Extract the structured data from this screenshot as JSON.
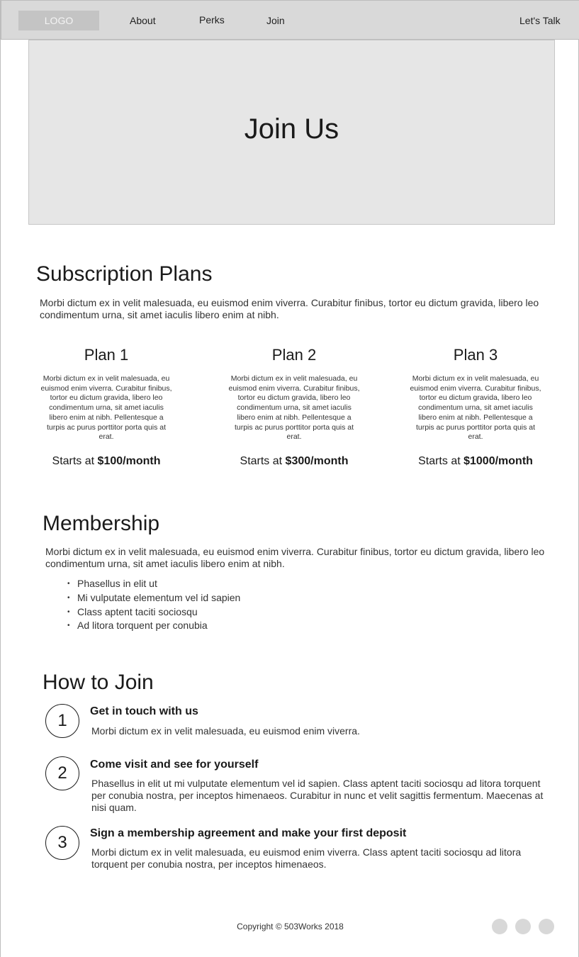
{
  "nav": {
    "logo": "LOGO",
    "links": [
      "About",
      "Perks",
      "Join"
    ],
    "cta": "Let's Talk"
  },
  "hero": {
    "title": "Join Us"
  },
  "subscription": {
    "title": "Subscription Plans",
    "intro": "Morbi dictum ex in velit malesuada, eu euismod enim viverra. Curabitur finibus, tortor eu dictum gravida, libero leo condimentum urna, sit amet iaculis libero enim at nibh.",
    "plans": [
      {
        "name": "Plan 1",
        "description": "Morbi dictum ex in velit malesuada, eu euismod enim viverra. Curabitur finibus, tortor eu dictum gravida, libero leo condimentum urna, sit amet iaculis libero enim at nibh. Pellentesque a turpis ac purus porttitor porta quis at erat.",
        "price_prefix": "Starts at",
        "price": "$100/month"
      },
      {
        "name": "Plan 2",
        "description": "Morbi dictum ex in velit malesuada, eu euismod enim viverra. Curabitur finibus, tortor eu dictum gravida, libero leo condimentum urna, sit amet iaculis libero enim at nibh. Pellentesque a turpis ac purus porttitor porta quis at erat.",
        "price_prefix": "Starts at",
        "price": "$300/month"
      },
      {
        "name": "Plan 3",
        "description": "Morbi dictum ex in velit malesuada, eu euismod enim viverra. Curabitur finibus, tortor eu dictum gravida, libero leo condimentum urna, sit amet iaculis libero enim at nibh. Pellentesque a turpis ac purus porttitor porta quis at erat.",
        "price_prefix": "Starts at",
        "price": "$1000/month"
      }
    ]
  },
  "membership": {
    "title": "Membership",
    "intro": "Morbi dictum ex in velit malesuada, eu euismod enim viverra. Curabitur finibus, tortor eu dictum gravida, libero leo condimentum urna, sit amet iaculis libero enim at nibh.",
    "items": [
      "Phasellus in elit ut",
      "Mi vulputate elementum vel id sapien",
      "Class aptent taciti sociosqu",
      "Ad litora torquent per conubia"
    ]
  },
  "how_to_join": {
    "title": "How to Join",
    "steps": [
      {
        "number": "1",
        "title": "Get in touch with us",
        "text": "Morbi dictum ex in velit malesuada, eu euismod enim viverra."
      },
      {
        "number": "2",
        "title": "Come visit and see for yourself",
        "text": "Phasellus in elit ut mi vulputate elementum vel id sapien. Class aptent taciti sociosqu ad litora torquent per conubia nostra, per inceptos himenaeos. Curabitur in nunc et velit sagittis fermentum. Maecenas at nisi quam."
      },
      {
        "number": "3",
        "title": "Sign a membership agreement and make your first deposit",
        "text": "Morbi dictum ex in velit malesuada, eu euismod enim viverra. Class aptent taciti sociosqu ad litora torquent per conubia nostra, per inceptos himenaeos."
      }
    ]
  },
  "footer": {
    "copyright": "Copyright © 503Works 2018"
  },
  "colors": {
    "nav_bg": "#d9d9d9",
    "hero_bg": "#e6e6e6",
    "logo_bg": "#c4c4c4",
    "social_bg": "#d8d8d8"
  }
}
